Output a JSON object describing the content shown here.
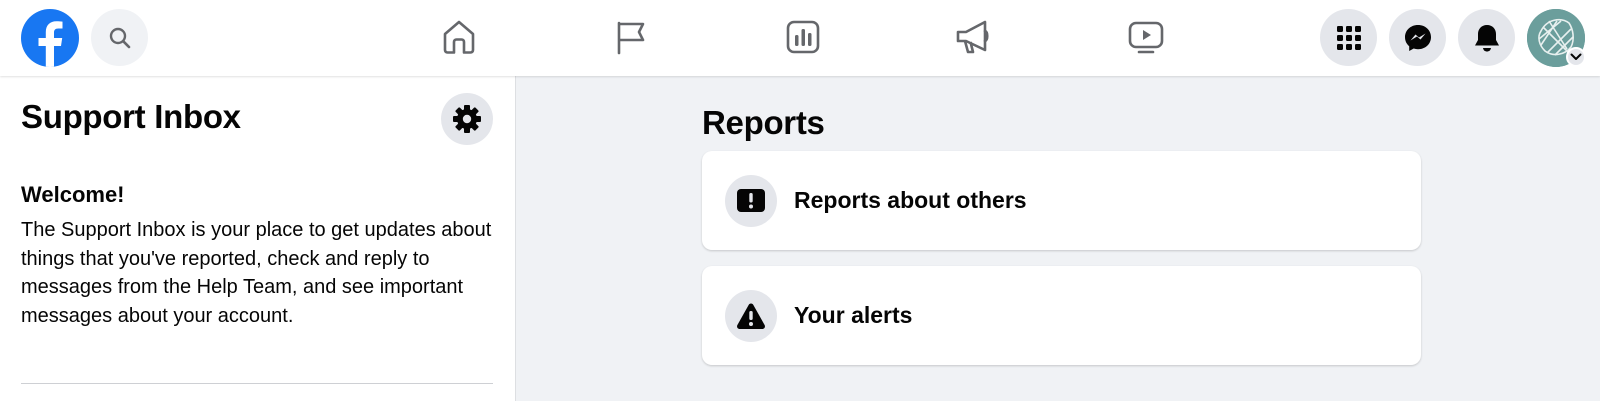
{
  "header": {
    "logo_icon": "facebook-logo",
    "search_icon": "search-icon",
    "nav": [
      {
        "name": "home",
        "icon": "home-icon"
      },
      {
        "name": "pages",
        "icon": "flag-icon"
      },
      {
        "name": "insights",
        "icon": "bar-chart-icon"
      },
      {
        "name": "ads",
        "icon": "megaphone-icon"
      },
      {
        "name": "watch",
        "icon": "video-icon"
      }
    ],
    "right": [
      {
        "name": "menu",
        "icon": "grid-menu-icon"
      },
      {
        "name": "messenger",
        "icon": "messenger-icon"
      },
      {
        "name": "notifications",
        "icon": "bell-icon"
      },
      {
        "name": "account",
        "icon": "avatar"
      }
    ]
  },
  "sidebar": {
    "title": "Support Inbox",
    "settings_icon": "gear-icon",
    "welcome_heading": "Welcome!",
    "welcome_text": "The Support Inbox is your place to get updates about things that you've reported, check and reply to messages from the Help Team, and see important messages about your account."
  },
  "main": {
    "title": "Reports",
    "cards": [
      {
        "label": "Reports about others",
        "icon": "report-exclamation-icon"
      },
      {
        "label": "Your alerts",
        "icon": "warning-triangle-icon"
      }
    ]
  },
  "colors": {
    "brand": "#1877f2",
    "page_bg": "#f0f2f5",
    "icon_bg": "#e4e6eb",
    "text": "#050505",
    "nav_icon": "#65676b"
  }
}
